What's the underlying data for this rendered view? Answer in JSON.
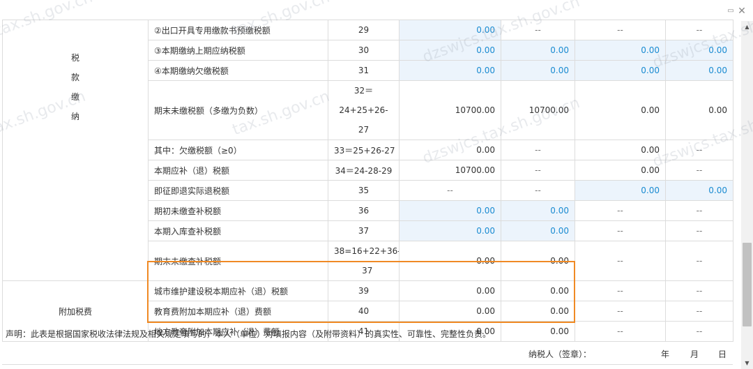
{
  "window": {
    "minimize_symbol": "▭",
    "close_symbol": "✕"
  },
  "watermarks": {
    "site1": "tax.sh.gov.cn",
    "site2": "dzswjcs.tax.sh.gov.cn"
  },
  "sections": {
    "tax_payment": [
      "税",
      "款",
      "缴",
      "纳"
    ],
    "surcharge": "附加税费"
  },
  "rows": [
    {
      "label": "②出口开具专用缴款书预缴税额",
      "line": "29",
      "c1": "0.00",
      "c2": "--",
      "c3": "--",
      "c4": "--"
    },
    {
      "label": "③本期缴纳上期应纳税额",
      "line": "30",
      "c1": "0.00",
      "c2": "0.00",
      "c3": "0.00",
      "c4": "0.00"
    },
    {
      "label": "④本期缴纳欠缴税额",
      "line": "31",
      "c1": "0.00",
      "c2": "0.00",
      "c3": "0.00",
      "c4": "0.00"
    },
    {
      "label": "期末未缴税额（多缴为负数）",
      "line_a": "32＝24+25+26-",
      "line_b": "27",
      "c1": "10700.00",
      "c2": "10700.00",
      "c3": "0.00",
      "c4": "0.00"
    },
    {
      "label": "其中：欠缴税额（≥0）",
      "line": "33＝25+26-27",
      "c1": "0.00",
      "c2": "--",
      "c3": "0.00",
      "c4": "--"
    },
    {
      "label": "本期应补（退）税额",
      "line": "34＝24-28-29",
      "c1": "10700.00",
      "c2": "--",
      "c3": "0.00",
      "c4": "--"
    },
    {
      "label": "即征即退实际退税额",
      "line": "35",
      "c1": "--",
      "c2": "--",
      "c3": "0.00",
      "c4": "0.00"
    },
    {
      "label": "期初未缴查补税额",
      "line": "36",
      "c1": "0.00",
      "c2": "0.00",
      "c3": "--",
      "c4": "--"
    },
    {
      "label": "本期入库查补税额",
      "line": "37",
      "c1": "0.00",
      "c2": "0.00",
      "c3": "--",
      "c4": "--"
    },
    {
      "label": "期末未缴查补税额",
      "line_a": "38=16+22+36-",
      "line_b": "37",
      "c1": "0.00",
      "c2": "0.00",
      "c3": "--",
      "c4": "--"
    },
    {
      "label": "城市维护建设税本期应补（退）税额",
      "line": "39",
      "c1": "0.00",
      "c2": "0.00",
      "c3": "--",
      "c4": "--"
    },
    {
      "label": "教育费附加本期应补（退）费额",
      "line": "40",
      "c1": "0.00",
      "c2": "0.00",
      "c3": "--",
      "c4": "--"
    },
    {
      "label": "地方教育附加本期应补（退）费额",
      "line": "41",
      "c1": "0.00",
      "c2": "0.00",
      "c3": "--",
      "c4": "--"
    }
  ],
  "footer": {
    "declaration": "声明：此表是根据国家税收法律法规及相关规定填写的，本人（单位）对填报内容（及附带资料）的真实性、可靠性、完整性负责。",
    "signature_label": "纳税人（签章）：",
    "year": "年",
    "month": "月",
    "day": "日"
  },
  "colors": {
    "input_bg": "#ecf4fc",
    "input_text": "#1a8bd1",
    "highlight": "#f08a24"
  }
}
